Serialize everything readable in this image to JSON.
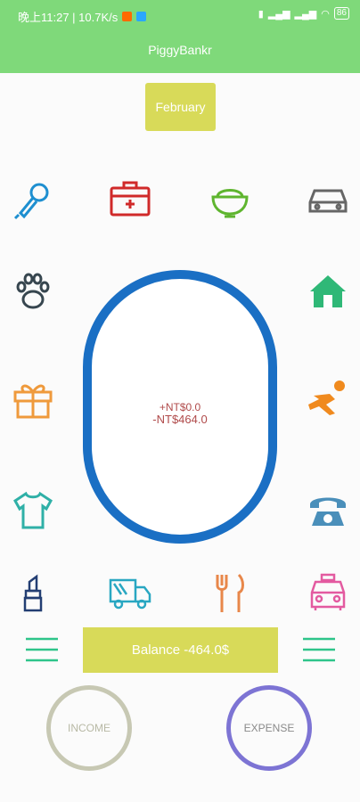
{
  "status": {
    "time_speed": "晚上11:27 | 10.7K/s",
    "battery": "86"
  },
  "app": {
    "title": "PiggyBankr"
  },
  "month": {
    "label": "February"
  },
  "summary": {
    "income": "+NT$0.0",
    "expense": "-NT$464.0"
  },
  "balance": {
    "label": "Balance -464.0$"
  },
  "buttons": {
    "income": "INCOME",
    "expense": "EXPENSE"
  },
  "categories": [
    {
      "icon": "microphone-icon",
      "color": "#1e8fd0"
    },
    {
      "icon": "first-aid-kit-icon",
      "color": "#d02a2a"
    },
    {
      "icon": "rice-bowl-icon",
      "color": "#5fb52f"
    },
    {
      "icon": "car-icon",
      "color": "#666666"
    },
    {
      "icon": "paw-icon",
      "color": "#37464f"
    },
    {
      "icon": "house-icon",
      "color": "#2fb877"
    },
    {
      "icon": "gift-icon",
      "color": "#ef9a3c"
    },
    {
      "icon": "running-person-icon",
      "color": "#f08a1e"
    },
    {
      "icon": "t-shirt-icon",
      "color": "#2fb0a7"
    },
    {
      "icon": "telephone-icon",
      "color": "#4a8fba"
    },
    {
      "icon": "lipstick-icon",
      "color": "#233e73"
    },
    {
      "icon": "delivery-truck-icon",
      "color": "#29a7c2"
    },
    {
      "icon": "fork-knife-icon",
      "color": "#e8874a"
    },
    {
      "icon": "taxi-icon",
      "color": "#e35aa0"
    }
  ],
  "colors": {
    "header": "#7fd97a",
    "accent": "#d8da59",
    "ring": "#1a6fc4"
  }
}
